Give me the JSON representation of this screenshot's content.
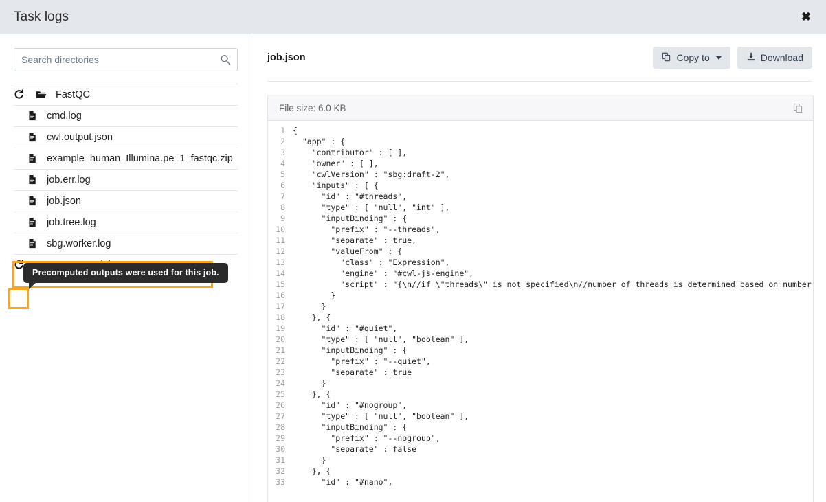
{
  "header": {
    "title": "Task logs",
    "close_icon": "close-icon"
  },
  "sidebar": {
    "search": {
      "placeholder": "Search directories",
      "value": "",
      "icon": "search-icon"
    },
    "tree": [
      {
        "label": "FastQC",
        "kind": "folder-open",
        "indent": 0,
        "refresh": true
      },
      {
        "label": "cmd.log",
        "kind": "file",
        "indent": 1,
        "refresh": false
      },
      {
        "label": "cwl.output.json",
        "kind": "file",
        "indent": 1,
        "refresh": false
      },
      {
        "label": "example_human_Illumina.pe_1_fastqc.zip",
        "kind": "file",
        "indent": 1,
        "refresh": false
      },
      {
        "label": "job.err.log",
        "kind": "file",
        "indent": 1,
        "refresh": false
      },
      {
        "label": "job.json",
        "kind": "file",
        "indent": 1,
        "refresh": false
      },
      {
        "label": "job.tree.log",
        "kind": "file",
        "indent": 1,
        "refresh": false
      },
      {
        "label": "sbg.worker.log",
        "kind": "file",
        "indent": 1,
        "refresh": false
      },
      {
        "label": "SBG_Html2b64_1_s",
        "kind": "folder",
        "indent": 0,
        "refresh": true
      }
    ],
    "tooltip": {
      "text": "Precomputed outputs were used for this job."
    },
    "highlight_color": "#f5a623"
  },
  "main": {
    "file_title": "job.json",
    "copy_to_label": "Copy to",
    "download_label": "Download",
    "file_size_label": "File size: 6.0 KB",
    "copy_icon": "copy-icon",
    "download_icon": "download-icon",
    "code_lines": [
      "{",
      "  \"app\" : {",
      "    \"contributor\" : [ ],",
      "    \"owner\" : [ ],",
      "    \"cwlVersion\" : \"sbg:draft-2\",",
      "    \"inputs\" : [ {",
      "      \"id\" : \"#threads\",",
      "      \"type\" : [ \"null\", \"int\" ],",
      "      \"inputBinding\" : {",
      "        \"prefix\" : \"--threads\",",
      "        \"separate\" : true,",
      "        \"valueFrom\" : {",
      "          \"class\" : \"Expression\",",
      "          \"engine\" : \"#cwl-js-engine\",",
      "          \"script\" : \"{\\n//if \\\"threads\\\" is not specified\\n//number of threads is determined based on number of inputs\\n  if",
      "        }",
      "      }",
      "    }, {",
      "      \"id\" : \"#quiet\",",
      "      \"type\" : [ \"null\", \"boolean\" ],",
      "      \"inputBinding\" : {",
      "        \"prefix\" : \"--quiet\",",
      "        \"separate\" : true",
      "      }",
      "    }, {",
      "      \"id\" : \"#nogroup\",",
      "      \"type\" : [ \"null\", \"boolean\" ],",
      "      \"inputBinding\" : {",
      "        \"prefix\" : \"--nogroup\",",
      "        \"separate\" : false",
      "      }",
      "    }, {",
      "      \"id\" : \"#nano\","
    ]
  }
}
